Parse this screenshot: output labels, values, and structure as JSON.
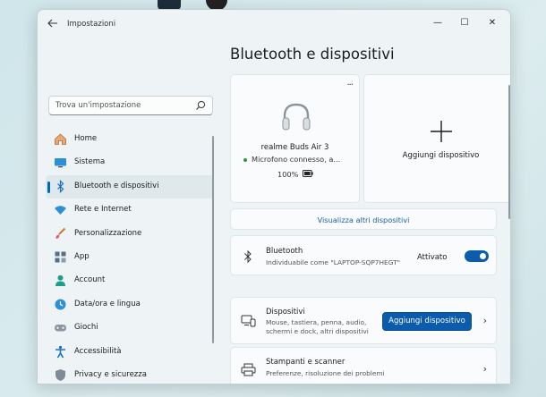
{
  "window": {
    "title": "Impostazioni",
    "controls": {
      "minimize": "—",
      "maximize": "☐",
      "close": "✕"
    }
  },
  "search": {
    "placeholder": "Trova un'impostazione"
  },
  "sidebar": {
    "items": [
      {
        "label": "Home",
        "icon": "home-icon",
        "active": false
      },
      {
        "label": "Sistema",
        "icon": "system-icon",
        "active": false
      },
      {
        "label": "Bluetooth e dispositivi",
        "icon": "bluetooth-icon",
        "active": true
      },
      {
        "label": "Rete e Internet",
        "icon": "wifi-icon",
        "active": false
      },
      {
        "label": "Personalizzazione",
        "icon": "brush-icon",
        "active": false
      },
      {
        "label": "App",
        "icon": "apps-icon",
        "active": false
      },
      {
        "label": "Account",
        "icon": "account-icon",
        "active": false
      },
      {
        "label": "Data/ora e lingua",
        "icon": "globe-clock-icon",
        "active": false
      },
      {
        "label": "Giochi",
        "icon": "gamepad-icon",
        "active": false
      },
      {
        "label": "Accessibilità",
        "icon": "accessibility-icon",
        "active": false
      },
      {
        "label": "Privacy e sicurezza",
        "icon": "shield-icon",
        "active": false
      }
    ]
  },
  "main": {
    "title": "Bluetooth e dispositivi",
    "device_card": {
      "more": "···",
      "name": "realme Buds Air 3",
      "status": "Microfono connesso, a...",
      "battery": "100%"
    },
    "add_card": {
      "label": "Aggiungi dispositivo"
    },
    "more_devices_link": "Visualizza altri dispositivi",
    "bluetooth_row": {
      "title": "Bluetooth",
      "subtitle": "Individuabile come \"LAPTOP-SQP7HEGT\"",
      "toggle_label": "Attivato",
      "toggle_on": true
    },
    "devices_row": {
      "title": "Dispositivi",
      "subtitle_line1": "Mouse, tastiera, penna, audio,",
      "subtitle_line2": "schermi e dock, altri dispositivi",
      "button": "Aggiungi dispositivo",
      "chevron": "›"
    },
    "printers_row": {
      "title": "Stampanti e scanner",
      "subtitle": "Preferenze, risoluzione dei problemi",
      "chevron": "›"
    }
  },
  "colors": {
    "accent": "#0b5cad",
    "link": "#1a5fa8",
    "window_bg": "#eef4f6",
    "card_bg": "#f9fbfc"
  }
}
